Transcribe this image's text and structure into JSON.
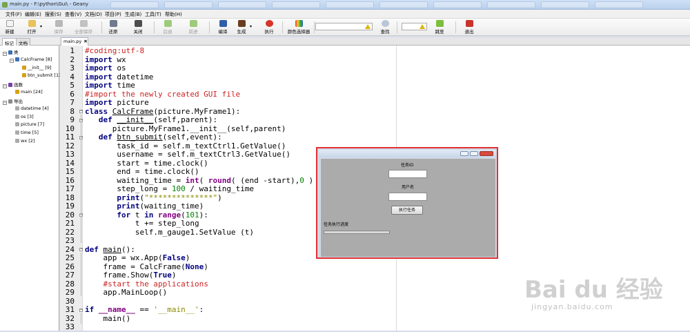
{
  "window": {
    "title": "main.py - F:\\python\\Gui\\ - Geany"
  },
  "menu": [
    "文件(F)",
    "编辑(E)",
    "搜索(S)",
    "查看(V)",
    "文档(D)",
    "项目(P)",
    "生成(B)",
    "工具(T)",
    "帮助(H)"
  ],
  "toolbar": {
    "buttons": [
      {
        "label": "新建",
        "icon": "new-file-icon",
        "enabled": true
      },
      {
        "label": "打开",
        "icon": "open-folder-icon",
        "enabled": true
      },
      {
        "label": "保存",
        "icon": "save-icon",
        "enabled": false
      },
      {
        "label": "全部保存",
        "icon": "save-all-icon",
        "enabled": false
      },
      {
        "label": "还原",
        "icon": "revert-icon",
        "enabled": true
      },
      {
        "label": "关闭",
        "icon": "close-icon",
        "enabled": true
      },
      {
        "label": "后退",
        "icon": "back-arrow-icon",
        "enabled": false
      },
      {
        "label": "前进",
        "icon": "forward-arrow-icon",
        "enabled": false
      },
      {
        "label": "编译",
        "icon": "compile-icon",
        "enabled": true
      },
      {
        "label": "生成",
        "icon": "build-icon",
        "enabled": true
      },
      {
        "label": "执行",
        "icon": "execute-icon",
        "enabled": true
      },
      {
        "label": "颜色选择器",
        "icon": "color-picker-icon",
        "enabled": true
      },
      {
        "label": "查找",
        "icon": "search-icon",
        "enabled": true
      },
      {
        "label": "跳至",
        "icon": "jump-icon",
        "enabled": true
      },
      {
        "label": "退出",
        "icon": "quit-icon",
        "enabled": true
      }
    ],
    "search_value": "",
    "goto_value": ""
  },
  "sidebar": {
    "tabs": [
      "标记",
      "文档"
    ],
    "tree": [
      {
        "label": "类",
        "level": 0,
        "icon": "class-group-icon"
      },
      {
        "label": "CalcFrame [8]",
        "level": 1,
        "icon": "class-icon"
      },
      {
        "label": "__init__ [9]",
        "level": 2,
        "icon": "method-icon"
      },
      {
        "label": "btn_submit [11]",
        "level": 2,
        "icon": "method-icon"
      },
      {
        "label": "函数",
        "level": 0,
        "icon": "function-group-icon"
      },
      {
        "label": "main [24]",
        "level": 1,
        "icon": "function-icon"
      },
      {
        "label": "导出",
        "level": 0,
        "icon": "import-group-icon"
      },
      {
        "label": "datetime [4]",
        "level": 1,
        "icon": "import-icon"
      },
      {
        "label": "os [3]",
        "level": 1,
        "icon": "import-icon"
      },
      {
        "label": "picture [7]",
        "level": 1,
        "icon": "import-icon"
      },
      {
        "label": "time [5]",
        "level": 1,
        "icon": "import-icon"
      },
      {
        "label": "wx [2]",
        "level": 1,
        "icon": "import-icon"
      }
    ]
  },
  "editor": {
    "file_tab": "main.py",
    "line_numbers": [
      "1",
      "2",
      "3",
      "4",
      "5",
      "6",
      "7",
      "8",
      "9",
      "10",
      "11",
      "12",
      "13",
      "14",
      "15",
      "16",
      "17",
      "18",
      "19",
      "20",
      "21",
      "22",
      "23",
      "24",
      "25",
      "26",
      "27",
      "28",
      "29",
      "30",
      "31",
      "32",
      "33"
    ]
  },
  "frame_window": {
    "task_id_label": "任务ID",
    "username_label": "用户名",
    "button_label": "执行任务",
    "progress_label": "任务执行进度",
    "progress": 0
  },
  "watermark": {
    "text": "Bai du 经验",
    "url": "jingyan.baidu.com"
  },
  "colors": {
    "keyword": "#00007f",
    "builtin": "#7f007f",
    "comment": "#cc2222",
    "number": "#007f00",
    "string": "#8a8a00",
    "highlight_border": "#e03030"
  }
}
